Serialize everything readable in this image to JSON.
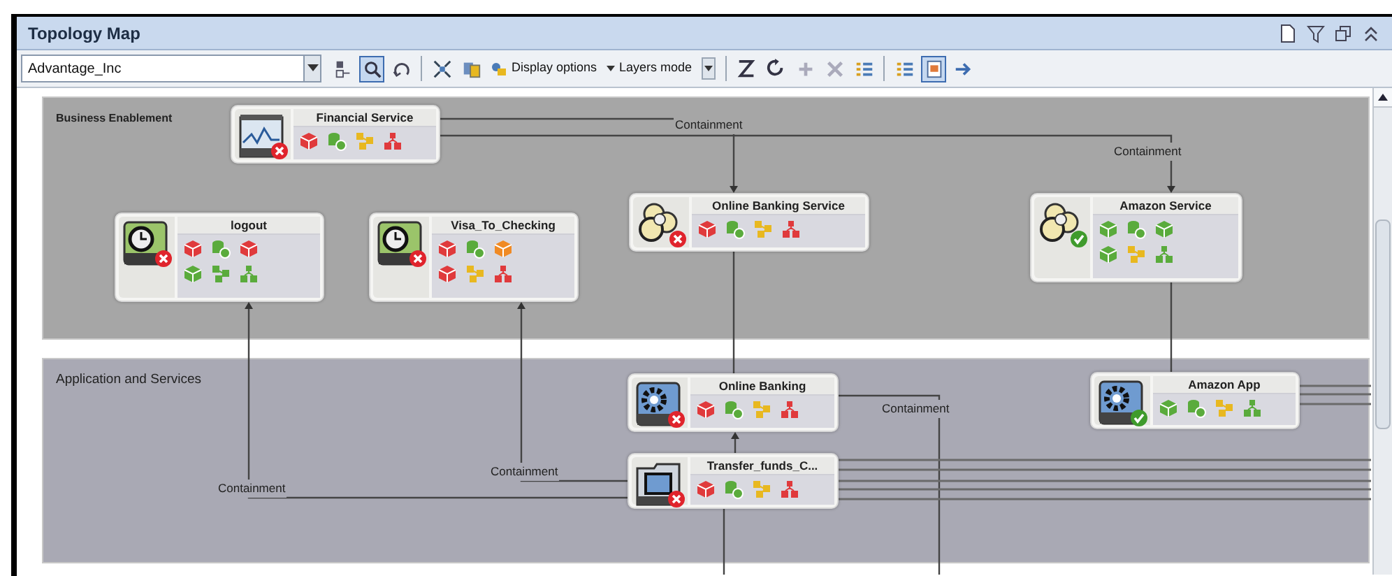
{
  "window": {
    "title": "Topology Map"
  },
  "toolbar": {
    "view_selector": {
      "value": "Advantage_Inc"
    },
    "items": [
      {
        "kind": "icon",
        "selected": false
      },
      {
        "kind": "icon",
        "selected": true
      },
      {
        "kind": "icon",
        "selected": false
      },
      {
        "kind": "separator"
      },
      {
        "kind": "icon",
        "selected": false
      },
      {
        "kind": "icon",
        "selected": false
      },
      {
        "kind": "menu",
        "label": "Display options"
      },
      {
        "kind": "menu",
        "label": "Layers mode"
      },
      {
        "kind": "separator"
      },
      {
        "kind": "icon",
        "selected": false
      },
      {
        "kind": "icon",
        "selected": false
      },
      {
        "kind": "icon",
        "selected": false
      },
      {
        "kind": "icon",
        "selected": false
      },
      {
        "kind": "icon",
        "selected": false
      },
      {
        "kind": "separator"
      },
      {
        "kind": "icon",
        "selected": false
      },
      {
        "kind": "icon",
        "selected": true
      },
      {
        "kind": "icon",
        "selected": false
      }
    ]
  },
  "layers": [
    {
      "name": "Business Enablement"
    },
    {
      "name": "Application and Services"
    }
  ],
  "nodes": [
    {
      "name": "Financial Service",
      "alert": true,
      "indicators": [
        [
          {
            "kind": "cube",
            "color": "#e03a3c"
          },
          {
            "kind": "cylinders",
            "color": "#5aab3c"
          },
          {
            "kind": "share",
            "color": "#e8b820"
          },
          {
            "kind": "tree",
            "color": "#e03a3c"
          }
        ]
      ]
    },
    {
      "name": "logout",
      "alert": true,
      "indicators": [
        [
          {
            "kind": "cube",
            "color": "#e03a3c"
          },
          {
            "kind": "cylinders",
            "color": "#5aab3c"
          },
          {
            "kind": "cube",
            "color": "#e03a3c"
          }
        ],
        [
          {
            "kind": "cube",
            "color": "#5aab3c"
          },
          {
            "kind": "share",
            "color": "#5aab3c"
          },
          {
            "kind": "tree",
            "color": "#5aab3c"
          }
        ]
      ]
    },
    {
      "name": "Visa_To_Checking",
      "alert": true,
      "indicators": [
        [
          {
            "kind": "cube",
            "color": "#e03a3c"
          },
          {
            "kind": "cylinders",
            "color": "#5aab3c"
          },
          {
            "kind": "cube",
            "color": "#f08a24"
          }
        ],
        [
          {
            "kind": "cube",
            "color": "#e03a3c"
          },
          {
            "kind": "share",
            "color": "#e8b820"
          },
          {
            "kind": "tree",
            "color": "#e03a3c"
          }
        ]
      ]
    },
    {
      "name": "Online Banking Service",
      "alert": true,
      "indicators": [
        [
          {
            "kind": "cube",
            "color": "#e03a3c"
          },
          {
            "kind": "cylinders",
            "color": "#5aab3c"
          },
          {
            "kind": "share",
            "color": "#e8b820"
          },
          {
            "kind": "tree",
            "color": "#e03a3c"
          }
        ]
      ]
    },
    {
      "name": "Amazon Service",
      "alert": false,
      "indicators": [
        [
          {
            "kind": "cube",
            "color": "#5aab3c"
          },
          {
            "kind": "cylinders",
            "color": "#5aab3c"
          },
          {
            "kind": "cube",
            "color": "#5aab3c"
          }
        ],
        [
          {
            "kind": "cube",
            "color": "#5aab3c"
          },
          {
            "kind": "share",
            "color": "#e8b820"
          },
          {
            "kind": "tree",
            "color": "#5aab3c"
          }
        ]
      ]
    },
    {
      "name": "Online Banking",
      "alert": true,
      "indicators": [
        [
          {
            "kind": "cube",
            "color": "#e03a3c"
          },
          {
            "kind": "cylinders",
            "color": "#5aab3c"
          },
          {
            "kind": "share",
            "color": "#e8b820"
          },
          {
            "kind": "tree",
            "color": "#e03a3c"
          }
        ]
      ]
    },
    {
      "name": "Transfer_funds_C...",
      "alert": true,
      "indicators": [
        [
          {
            "kind": "cube",
            "color": "#e03a3c"
          },
          {
            "kind": "cylinders",
            "color": "#5aab3c"
          },
          {
            "kind": "share",
            "color": "#e8b820"
          },
          {
            "kind": "tree",
            "color": "#e03a3c"
          }
        ]
      ]
    },
    {
      "name": "Amazon App",
      "alert": false,
      "indicators": [
        [
          {
            "kind": "cube",
            "color": "#5aab3c"
          },
          {
            "kind": "cylinders",
            "color": "#5aab3c"
          },
          {
            "kind": "share",
            "color": "#e8b820"
          },
          {
            "kind": "tree",
            "color": "#5aab3c"
          }
        ]
      ]
    }
  ],
  "edges": [
    {
      "label": "Containment"
    },
    {
      "label": "Containment"
    },
    {
      "label": "Containment"
    },
    {
      "label": "Containment"
    },
    {
      "label": "Containment"
    }
  ]
}
